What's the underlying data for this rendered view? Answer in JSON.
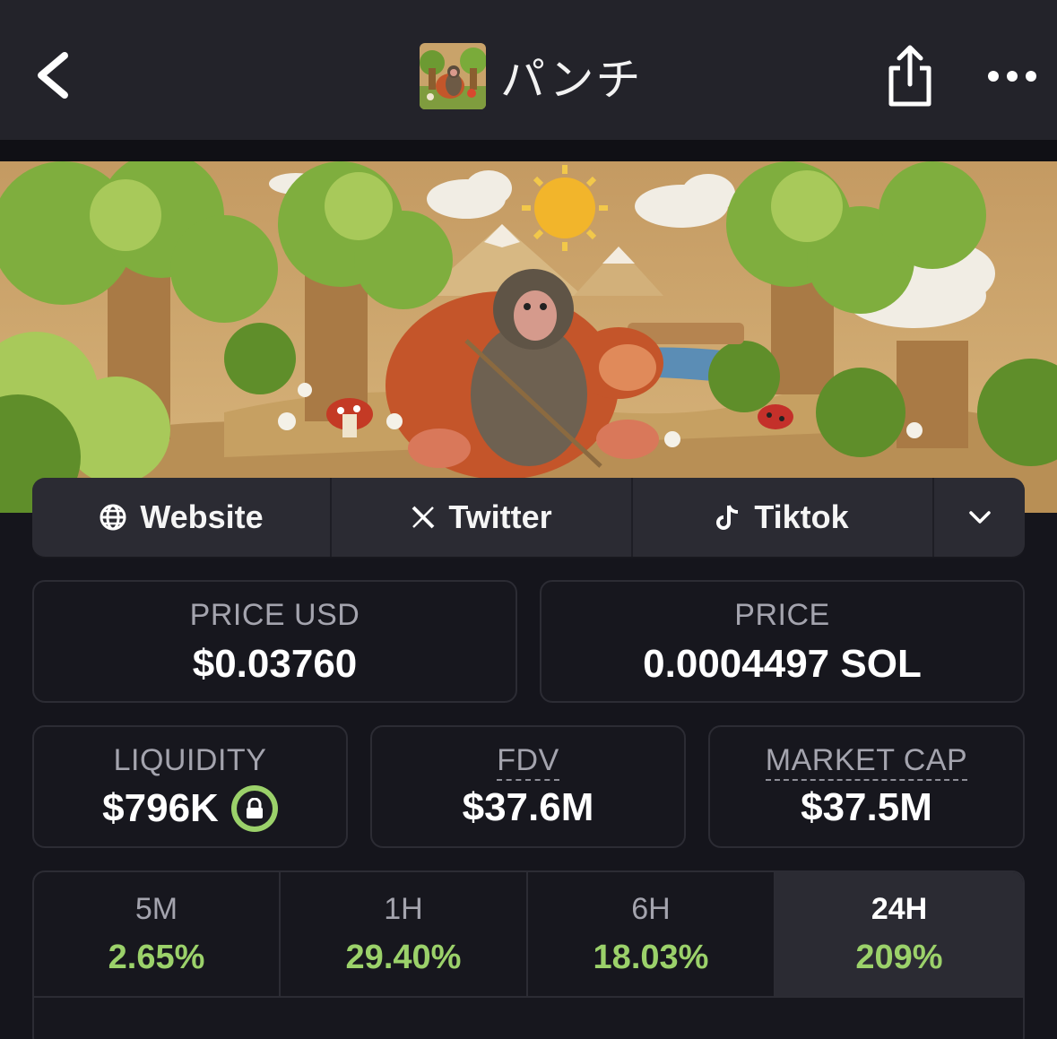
{
  "header": {
    "title": "パンチ",
    "icons": {
      "back": "chevron-left-icon",
      "share": "share-icon",
      "more": "more-dots-icon"
    }
  },
  "links": [
    {
      "label": "Website",
      "icon": "globe-icon"
    },
    {
      "label": "Twitter",
      "icon": "x-logo-icon"
    },
    {
      "label": "Tiktok",
      "icon": "tiktok-icon"
    }
  ],
  "stats": {
    "price_usd": {
      "label": "PRICE USD",
      "value": "$0.03760"
    },
    "price_native": {
      "label": "PRICE",
      "value": "0.0004497 SOL"
    },
    "liquidity": {
      "label": "LIQUIDITY",
      "value": "$796K"
    },
    "fdv": {
      "label": "FDV",
      "value": "$37.6M"
    },
    "market_cap": {
      "label": "MARKET CAP",
      "value": "$37.5M"
    }
  },
  "changes": [
    {
      "period": "5M",
      "change": "2.65%"
    },
    {
      "period": "1H",
      "change": "29.40%"
    },
    {
      "period": "6H",
      "change": "18.03%"
    },
    {
      "period": "24H",
      "change": "209%",
      "active": true
    }
  ],
  "colors": {
    "positive": "#9bd16a",
    "background": "#15151c",
    "card": "#2b2b33"
  }
}
